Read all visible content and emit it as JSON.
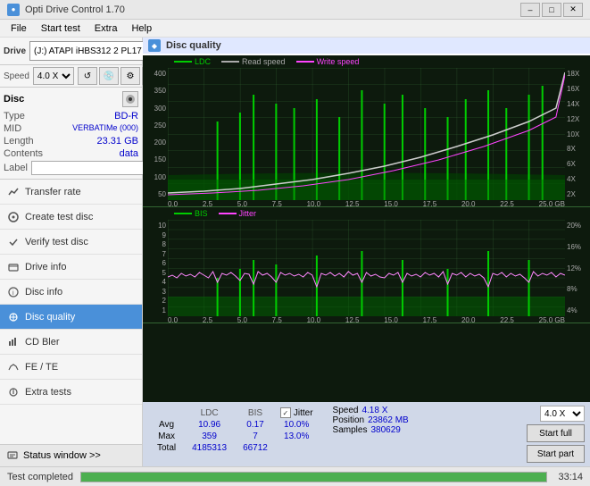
{
  "titlebar": {
    "title": "Opti Drive Control 1.70",
    "icon": "●",
    "min_btn": "–",
    "max_btn": "□",
    "close_btn": "✕"
  },
  "menubar": {
    "items": [
      "File",
      "Start test",
      "Extra",
      "Help"
    ]
  },
  "drive": {
    "label": "Drive",
    "select_value": "(J:) ATAPI iHBS312  2 PL17",
    "speed_label": "Speed",
    "speed_value": "4.0 X"
  },
  "disc": {
    "type_label": "Type",
    "type_value": "BD-R",
    "mid_label": "MID",
    "mid_value": "VERBATIMe (000)",
    "length_label": "Length",
    "length_value": "23.31 GB",
    "contents_label": "Contents",
    "contents_value": "data",
    "label_label": "Label"
  },
  "nav": {
    "items": [
      {
        "id": "transfer-rate",
        "label": "Transfer rate",
        "icon": "📈"
      },
      {
        "id": "create-test-disc",
        "label": "Create test disc",
        "icon": "💿"
      },
      {
        "id": "verify-test-disc",
        "label": "Verify test disc",
        "icon": "✔"
      },
      {
        "id": "drive-info",
        "label": "Drive info",
        "icon": "ℹ"
      },
      {
        "id": "disc-info",
        "label": "Disc info",
        "icon": "📋"
      },
      {
        "id": "disc-quality",
        "label": "Disc quality",
        "icon": "🔬",
        "active": true
      },
      {
        "id": "cd-bler",
        "label": "CD Bler",
        "icon": "📊"
      },
      {
        "id": "fe-te",
        "label": "FE / TE",
        "icon": "📉"
      },
      {
        "id": "extra-tests",
        "label": "Extra tests",
        "icon": "🔧"
      }
    ],
    "status_window": "Status window >>"
  },
  "dq": {
    "title": "Disc quality",
    "legend_upper": [
      {
        "label": "LDC",
        "color": "#00cc00"
      },
      {
        "label": "Read speed",
        "color": "#aaaaaa"
      },
      {
        "label": "Write speed",
        "color": "#ff44ff"
      }
    ],
    "legend_lower": [
      {
        "label": "BIS",
        "color": "#00cc00"
      },
      {
        "label": "Jitter",
        "color": "#ff44ff"
      }
    ],
    "upper_y_left": [
      "400",
      "350",
      "300",
      "250",
      "200",
      "150",
      "100",
      "50"
    ],
    "upper_y_right": [
      "18X",
      "16X",
      "14X",
      "12X",
      "10X",
      "8X",
      "6X",
      "4X",
      "2X"
    ],
    "lower_y_left": [
      "10",
      "9",
      "8",
      "7",
      "6",
      "5",
      "4",
      "3",
      "2",
      "1"
    ],
    "lower_y_right": [
      "20%",
      "16%",
      "12%",
      "8%",
      "4%"
    ],
    "x_labels": [
      "0.0",
      "2.5",
      "5.0",
      "7.5",
      "10.0",
      "12.5",
      "15.0",
      "17.5",
      "20.0",
      "22.5",
      "25.0"
    ],
    "x_unit": "GB"
  },
  "stats": {
    "ldc_label": "LDC",
    "bis_label": "BIS",
    "jitter_label": "Jitter",
    "speed_label": "Speed",
    "position_label": "Position",
    "samples_label": "Samples",
    "avg_label": "Avg",
    "max_label": "Max",
    "total_label": "Total",
    "ldc_avg": "10.96",
    "ldc_max": "359",
    "ldc_total": "4185313",
    "bis_avg": "0.17",
    "bis_max": "7",
    "bis_total": "66712",
    "jitter_avg": "10.0%",
    "jitter_max": "13.0%",
    "speed_val": "4.18 X",
    "position_val": "23862 MB",
    "samples_val": "380629",
    "speed_select": "4.0 X",
    "start_full": "Start full",
    "start_part": "Start part",
    "jitter_checked": "✓"
  },
  "statusbar": {
    "text": "Test completed",
    "progress": 100,
    "time": "33:14"
  },
  "colors": {
    "accent": "#4a90d9",
    "green": "#00cc00",
    "dark_green": "#0d1a0d",
    "grid_line": "#336633",
    "pink": "#ff44ff",
    "white_line": "#cccccc",
    "active_nav_bg": "#4a90d9",
    "active_nav_text": "#ffffff"
  }
}
